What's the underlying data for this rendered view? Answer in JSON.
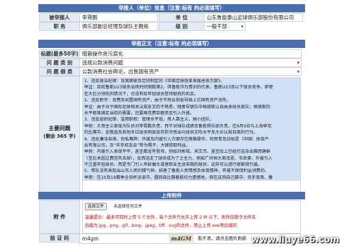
{
  "reporter_section": {
    "header": "举报人（单位）信息（注意:标有   的必须填写）",
    "name_label": "被举报人",
    "name_value": "李霄鹏",
    "unit_label": "单       位",
    "unit_value": "山东鲁能泰山足球俱乐部股份有限公司",
    "position_label": "职       务",
    "position_value": "俱乐部副总经理及球队主教练",
    "level_label": "级       别",
    "level_value": "一般干部"
  },
  "report_section": {
    "header": "举报正文（注意:标有   的必须填写）",
    "title_label": "标题(最多50字)",
    "title_value": "暗箱操作贪污腐化",
    "category_label": "问 题 类 别",
    "category_value": "违规公款消费问题",
    "detail_label": "问 题 细 类",
    "detail_value": "公款消费社会舆论，出售国有资产",
    "main_issue_label": "主要问题",
    "main_issue_sub": "(剩余 365 字)",
    "body_lines": [
      "1、违反政治纪律：背离国家及足协制定的《中国足球改革发展总体方案》。",
      "举证：目前鲁能U23球员出场时间倒数第2，但鲁能作为青训的代表，鲁能U23及以下球员竞争。即使",
      "在大比分领先的情况下，也没有给年轻球员登场锻炼的机会。",
      "2、违反职守：浪费及闲置国有资产，由于不同业指俗导致上亿国有资产流失。",
      "举证：由于对于国际足联相关法规条文的不熟悉，随意导致队中格德斯以自由身球员离队；格德斯的",
      "水平能够满足当前的需要，还要再花费巨额资金引入外援。",
      "3、违反组织纪律、滥用职权：管理水平低，用人靠主义，搞小团队。",
      "举例：大哥主义表现为队员对李霄鹏负责，而不对球队成绩及鲁能俱乐部负责，在9月9日与上海申花",
      "的比赛中，金敬道及其他多位球员明显放弃防守而出与球员实际水平及大众认知背离的行为。",
      "4、违反廉洁自律、伪私舞弊：外援及内援引入方面存在暗箱操作，利用青岛训局是（中国）体育产",
      "业有限公司，及“华东校友会”等为幌子，大肆捞取利益。",
      "举例：内援引入表现平平，甚至都没有登场，例如刘彬瑶、宋文杰、甚至给上已经打这余出赛而建群",
      "（至比关超过费劳失去球），反而送走了球员成为了之主力，例如广州恒大周浑夏、韦世豪、外援引入",
      "不注重年轻球员，而是专门引入年龄偏大或者职业生涯末期的球员，这样可以进行很繁琐引援。",
      "5、帮队没有表现出山东人民的精气神，损害了鲁能人民情感及体育精神，有毫不顾惜利益消费的。",
      "举例：在10及19赛季全协杯淡谈中，圆回自比赛着能均力遗憾地，但在这回自己赛中，贡手菲燕、藤"
    ]
  },
  "upload_section": {
    "header": "上传附件",
    "attach_label": "附       件",
    "choose_file_btn": "选择文件",
    "no_file_text": "未选择任何文件",
    "tip_line1": "温馨提示：最多可同时上传 5 个文件，每个文件只允许上传 2 M 以下，附件仅限于文件名",
    "tip_line2": "后缀为.jpg, .png, .gif, .bmp, .jpeg, .tiff, .svg的文件，禁止上传.exe等后缀的",
    "captcha_label": "验 证 码",
    "captcha_input": "m4gm",
    "captcha_image_text": "m4GM",
    "captcha_hint": "看不清，请点击图片刷新",
    "watermark": "www.liuye66.com"
  },
  "colors": {
    "header_bg": "#4a6fb0",
    "label_bg": "#e4ebf5",
    "highlight": "#cfe0f7",
    "tip_red": "#cc0000"
  }
}
